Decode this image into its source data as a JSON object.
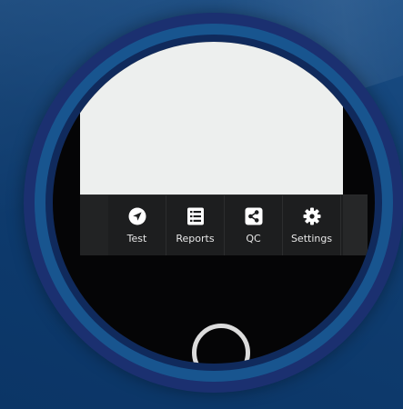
{
  "nav": {
    "items": [
      {
        "label": "Test",
        "icon": "navigation-arrow-icon"
      },
      {
        "label": "Reports",
        "icon": "list-document-icon"
      },
      {
        "label": "QC",
        "icon": "share-icon"
      },
      {
        "label": "Settings",
        "icon": "gear-icon"
      }
    ]
  },
  "colors": {
    "background": "#0f3f72",
    "bezel_outer": "#1b3070",
    "bezel_ring": "#18558f",
    "screen": "#050506",
    "content": "#edefee",
    "nav_bar": "#1d1e1f",
    "nav_text": "#e8e8e8",
    "home_ring": "#dcdcdc"
  }
}
